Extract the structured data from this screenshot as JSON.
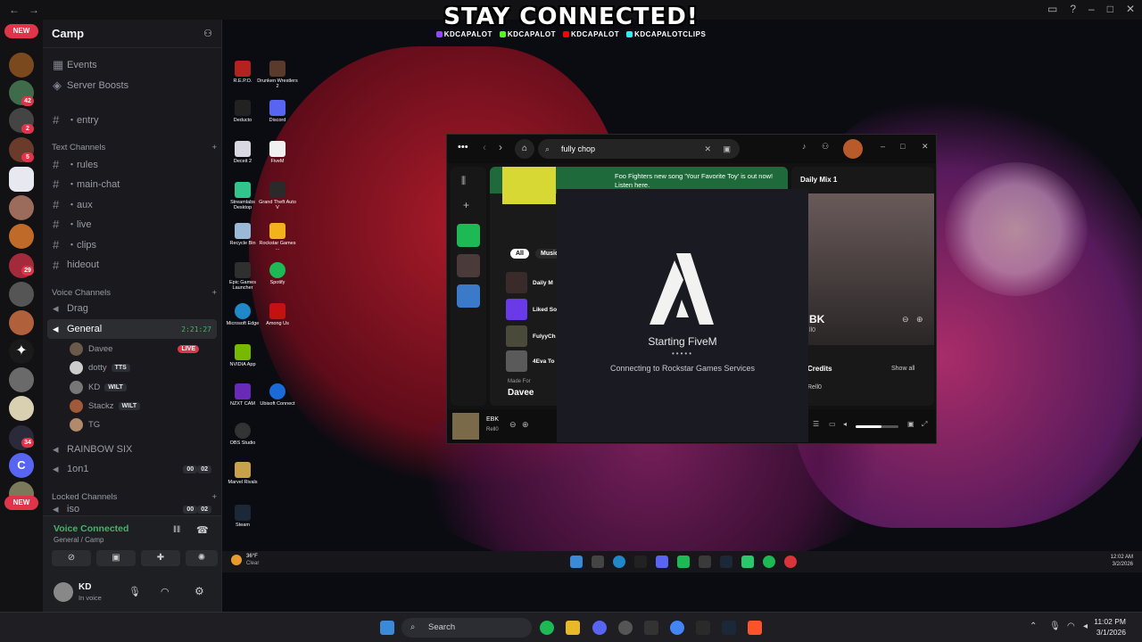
{
  "overlay": {
    "title": "STAY CONNECTED!",
    "socials": [
      "KDCAPALOT",
      "KDCAPALOT",
      "KDCAPALOT",
      "KDCAPALOTCLIPS"
    ]
  },
  "rail": {
    "new_top": "NEW",
    "new_bottom": "NEW",
    "badges": [
      "42",
      "2",
      "5",
      "29",
      "34"
    ],
    "letter_server": "C"
  },
  "server": {
    "name": "Camp",
    "events": "Events",
    "boosts": "Server Boosts",
    "entry": "・entry",
    "text_category": "Text Channels",
    "text_channels": [
      "・rules",
      "・main-chat",
      "・aux",
      "・live",
      "・clips",
      "hideout"
    ],
    "voice_category": "Voice Channels",
    "drag": "Drag",
    "general": "General",
    "general_timer": "2:21:27",
    "voice_users": [
      {
        "name": "Davee",
        "tag": "LIVE"
      },
      {
        "name": "dotty",
        "tag": "TTS"
      },
      {
        "name": "KD",
        "tag": "WILT"
      },
      {
        "name": "Stackz",
        "tag": "WILT"
      },
      {
        "name": "TG",
        "tag": ""
      }
    ],
    "rainbow": "RAINBOW SIX",
    "onon": "1on1",
    "onon_count_a": "00",
    "onon_count_b": "02",
    "locked_category": "Locked Channels",
    "locked_item": "iso",
    "locked_count_a": "00",
    "locked_count_b": "02"
  },
  "voice_panel": {
    "status": "Voice Connected",
    "sub": "General / Camp",
    "username": "KD",
    "user_sub": "In voice"
  },
  "desktop_icons": [
    "R.E.P.O.",
    "Drunken Wrestlers 2",
    "Deducto",
    "Discord",
    "Deceit 2",
    "FiveM",
    "Streamlabs Desktop",
    "Grand Theft Auto V",
    "Recycle Bin",
    "Rockstar Games ...",
    "Epic Games Launcher",
    "Spotify",
    "Microsoft Edge",
    "Among Us",
    "NVIDIA App",
    "NZXT CAM",
    "Ubisoft Connect",
    "OBS Studio",
    "Marvel Rivals",
    "Steam"
  ],
  "spotify": {
    "search": "fully chop",
    "news": "Foo Fighters new song 'Your Favorite Toy' is out now! Listen here.",
    "filter_all": "All",
    "filter_music": "Music",
    "list": [
      "Daily M",
      "Liked So",
      "FulyyCh",
      "4Eva To"
    ],
    "made_for": "Made For",
    "made_for_name": "Davee",
    "right_title": "Daily Mix 1",
    "right_track": "BK",
    "right_artist": "ll0",
    "credits": "Credits",
    "show_all": "Show all",
    "credits_artist": "Rell0",
    "now_playing_title": "EBK",
    "now_playing_artist": "Rell0"
  },
  "fivem": {
    "title": "Starting FiveM",
    "dots": "•••••",
    "status": "Connecting to Rockstar Games Services"
  },
  "inner_taskbar": {
    "weather_temp": "36°F",
    "weather_desc": "Clear",
    "time": "12:02 AM",
    "date": "3/2/2026"
  },
  "taskbar": {
    "search": "Search",
    "time": "11:02 PM",
    "date": "3/1/2026"
  }
}
